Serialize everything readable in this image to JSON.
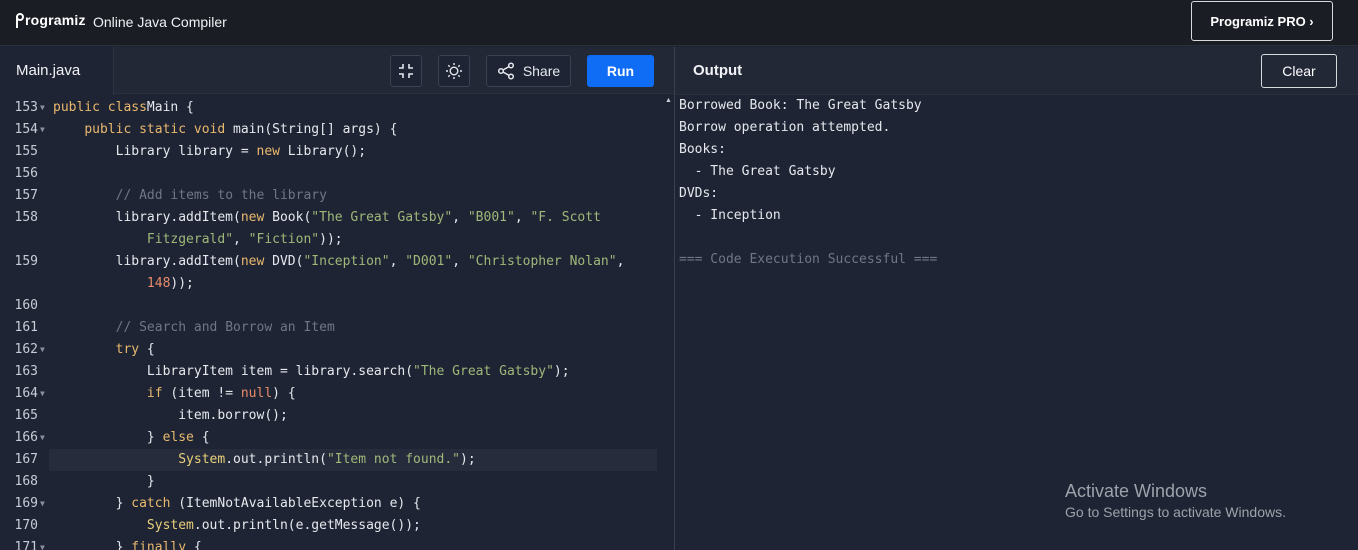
{
  "header": {
    "logo_text": "rogramiz",
    "app_title": "Online Java Compiler",
    "pro_button": "Programiz PRO ›"
  },
  "editor": {
    "file_tab": "Main.java",
    "share_label": "Share",
    "run_label": "Run",
    "icons": [
      "collapse-icon",
      "sun-icon",
      "share-icon"
    ],
    "lines": [
      {
        "num": "153",
        "fold": true,
        "tokens": [
          [
            "kw",
            "public class"
          ],
          [
            "",
            "Main {"
          ]
        ]
      },
      {
        "num": "154",
        "fold": true,
        "tokens": [
          [
            "",
            "    "
          ],
          [
            "kw",
            "public static void"
          ],
          [
            "",
            " main(String[] args) {"
          ]
        ]
      },
      {
        "num": "155",
        "fold": false,
        "tokens": [
          [
            "",
            "        Library library = "
          ],
          [
            "kw",
            "new"
          ],
          [
            "",
            " Library();"
          ]
        ]
      },
      {
        "num": "156",
        "fold": false,
        "tokens": [
          [
            "",
            ""
          ]
        ]
      },
      {
        "num": "157",
        "fold": false,
        "tokens": [
          [
            "",
            "        "
          ],
          [
            "cm",
            "// Add items to the library"
          ]
        ]
      },
      {
        "num": "158",
        "fold": false,
        "tokens": [
          [
            "",
            "        library.addItem("
          ],
          [
            "kw",
            "new"
          ],
          [
            "",
            " Book("
          ],
          [
            "str",
            "\"The Great Gatsby\""
          ],
          [
            "",
            ", "
          ],
          [
            "str",
            "\"B001\""
          ],
          [
            "",
            ", "
          ],
          [
            "str",
            "\"F. Scott"
          ]
        ]
      },
      {
        "num": "",
        "fold": false,
        "tokens": [
          [
            "",
            "            "
          ],
          [
            "str",
            "Fitzgerald\""
          ],
          [
            "",
            ", "
          ],
          [
            "str",
            "\"Fiction\""
          ],
          [
            "",
            "));"
          ]
        ]
      },
      {
        "num": "159",
        "fold": false,
        "tokens": [
          [
            "",
            "        library.addItem("
          ],
          [
            "kw",
            "new"
          ],
          [
            "",
            " DVD("
          ],
          [
            "str",
            "\"Inception\""
          ],
          [
            "",
            ", "
          ],
          [
            "str",
            "\"D001\""
          ],
          [
            "",
            ", "
          ],
          [
            "str",
            "\"Christopher Nolan\""
          ],
          [
            "",
            ","
          ]
        ]
      },
      {
        "num": "",
        "fold": false,
        "tokens": [
          [
            "",
            "            "
          ],
          [
            "num",
            "148"
          ],
          [
            "",
            "));"
          ]
        ]
      },
      {
        "num": "160",
        "fold": false,
        "tokens": [
          [
            "",
            ""
          ]
        ]
      },
      {
        "num": "161",
        "fold": false,
        "tokens": [
          [
            "",
            "        "
          ],
          [
            "cm",
            "// Search and Borrow an Item"
          ]
        ]
      },
      {
        "num": "162",
        "fold": true,
        "tokens": [
          [
            "",
            "        "
          ],
          [
            "kw",
            "try"
          ],
          [
            "",
            " {"
          ]
        ]
      },
      {
        "num": "163",
        "fold": false,
        "tokens": [
          [
            "",
            "            LibraryItem item = library.search("
          ],
          [
            "str",
            "\"The Great Gatsby\""
          ],
          [
            "",
            ");"
          ]
        ]
      },
      {
        "num": "164",
        "fold": true,
        "tokens": [
          [
            "",
            "            "
          ],
          [
            "kw",
            "if"
          ],
          [
            "",
            " (item != "
          ],
          [
            "kw2",
            "null"
          ],
          [
            "",
            ") {"
          ]
        ]
      },
      {
        "num": "165",
        "fold": false,
        "tokens": [
          [
            "",
            "                item.borrow();"
          ]
        ]
      },
      {
        "num": "166",
        "fold": true,
        "tokens": [
          [
            "",
            "            } "
          ],
          [
            "kw",
            "else"
          ],
          [
            "",
            " {"
          ]
        ]
      },
      {
        "num": "167",
        "fold": false,
        "active": true,
        "tokens": [
          [
            "",
            "                "
          ],
          [
            "sys",
            "System"
          ],
          [
            "",
            ".out.println("
          ],
          [
            "str",
            "\"Item not found.\""
          ],
          [
            "",
            ");"
          ]
        ]
      },
      {
        "num": "168",
        "fold": false,
        "tokens": [
          [
            "",
            "            }"
          ]
        ]
      },
      {
        "num": "169",
        "fold": true,
        "tokens": [
          [
            "",
            "        } "
          ],
          [
            "kw",
            "catch"
          ],
          [
            "",
            " (ItemNotAvailableException e) {"
          ]
        ]
      },
      {
        "num": "170",
        "fold": false,
        "tokens": [
          [
            "",
            "            "
          ],
          [
            "sys",
            "System"
          ],
          [
            "",
            ".out.println(e.getMessage());"
          ]
        ]
      },
      {
        "num": "171",
        "fold": true,
        "tokens": [
          [
            "",
            "        } "
          ],
          [
            "kw",
            "finally"
          ],
          [
            "",
            " {"
          ]
        ]
      }
    ]
  },
  "output": {
    "title": "Output",
    "clear_label": "Clear",
    "lines": [
      "Borrowed Book: The Great Gatsby",
      "Borrow operation attempted.",
      "Books:",
      "  - The Great Gatsby",
      "DVDs:",
      "  - Inception",
      ""
    ],
    "success": "=== Code Execution Successful ==="
  },
  "watermark": {
    "title": "Activate Windows",
    "subtitle": "Go to Settings to activate Windows."
  }
}
